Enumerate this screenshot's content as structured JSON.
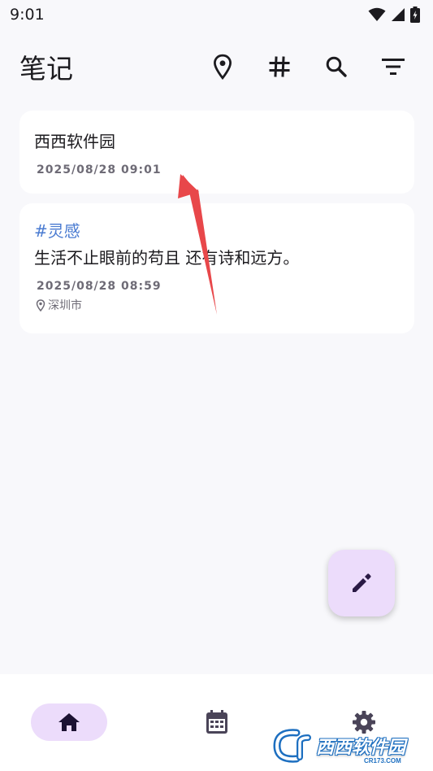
{
  "status_bar": {
    "time": "9:01",
    "icons": [
      "wifi-icon",
      "signal-icon",
      "battery-charging-icon"
    ]
  },
  "app_bar": {
    "title": "笔记",
    "actions": [
      "location-pin-icon",
      "hashtag-icon",
      "search-icon",
      "filter-icon"
    ]
  },
  "notes": [
    {
      "title": "西西软件园",
      "date": "2025/08/28 09:01"
    },
    {
      "tag": "#灵感",
      "title": "生活不止眼前的苟且 还有诗和远方。",
      "date": "2025/08/28 08:59",
      "location": "深圳市"
    }
  ],
  "fab": {
    "icon": "edit-pencil-icon"
  },
  "bottom_nav": [
    {
      "icon": "home-icon",
      "selected": true
    },
    {
      "icon": "calendar-icon",
      "selected": false
    },
    {
      "icon": "settings-gear-icon",
      "selected": false
    }
  ],
  "watermark": {
    "text": "西西软件园",
    "subtext": "CR173.COM"
  },
  "colors": {
    "background": "#f8f8fb",
    "card": "#ffffff",
    "accent_container": "#ecdcfb",
    "tag": "#4a7bd1",
    "annotation_arrow": "#e8474a",
    "icon_dark": "#1c1b1f"
  }
}
